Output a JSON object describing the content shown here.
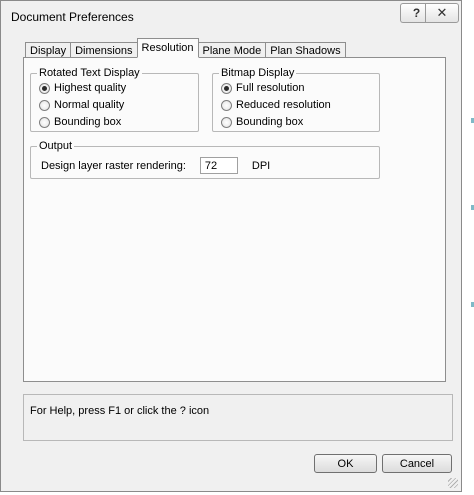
{
  "window": {
    "title": "Document Preferences",
    "help_glyph": "?",
    "close_glyph": "✕"
  },
  "tabs": [
    {
      "label": "Display",
      "active": false
    },
    {
      "label": "Dimensions",
      "active": false
    },
    {
      "label": "Resolution",
      "active": true
    },
    {
      "label": "Plane Mode",
      "active": false
    },
    {
      "label": "Plan Shadows",
      "active": false
    }
  ],
  "rotated_text_display": {
    "label": "Rotated Text Display",
    "options": [
      {
        "label": "Highest quality",
        "checked": true
      },
      {
        "label": "Normal quality",
        "checked": false
      },
      {
        "label": "Bounding box",
        "checked": false
      }
    ]
  },
  "bitmap_display": {
    "label": "Bitmap Display",
    "options": [
      {
        "label": "Full resolution",
        "checked": true
      },
      {
        "label": "Reduced resolution",
        "checked": false
      },
      {
        "label": "Bounding box",
        "checked": false
      }
    ]
  },
  "output": {
    "label": "Output",
    "field_label": "Design layer raster rendering:",
    "value": "72",
    "unit": "DPI"
  },
  "help_text": "For Help, press F1 or click the ? icon",
  "buttons": {
    "ok": "OK",
    "cancel": "Cancel"
  }
}
